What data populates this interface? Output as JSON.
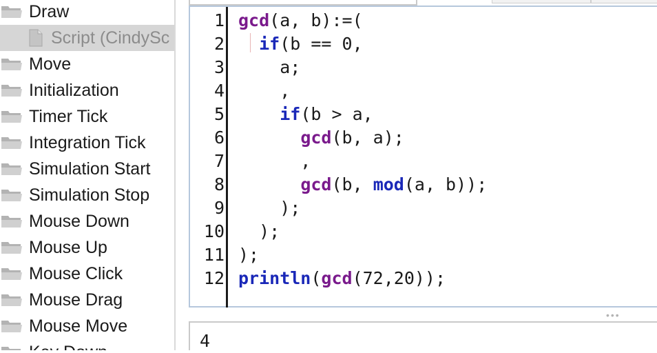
{
  "sidebar": {
    "items": [
      {
        "label": "Draw",
        "icon": "folder-icon"
      },
      {
        "label": "Script (CindySc",
        "icon": "document-icon",
        "selected": true
      },
      {
        "label": "Move",
        "icon": "folder-icon"
      },
      {
        "label": "Initialization",
        "icon": "folder-icon"
      },
      {
        "label": "Timer Tick",
        "icon": "folder-icon"
      },
      {
        "label": "Integration Tick",
        "icon": "folder-icon"
      },
      {
        "label": "Simulation Start",
        "icon": "folder-icon"
      },
      {
        "label": "Simulation Stop",
        "icon": "folder-icon"
      },
      {
        "label": "Mouse Down",
        "icon": "folder-icon"
      },
      {
        "label": "Mouse Up",
        "icon": "folder-icon"
      },
      {
        "label": "Mouse Click",
        "icon": "folder-icon"
      },
      {
        "label": "Mouse Drag",
        "icon": "folder-icon"
      },
      {
        "label": "Mouse Move",
        "icon": "folder-icon"
      },
      {
        "label": "Key Down",
        "icon": "folder-icon"
      }
    ]
  },
  "editor": {
    "line_numbers": [
      "1",
      "2",
      "3",
      "4",
      "5",
      "6",
      "7",
      "8",
      "9",
      "10",
      "11",
      "12"
    ],
    "lines": [
      [
        {
          "t": "gcd",
          "c": "fn"
        },
        {
          "t": "(a, b):=(",
          "c": ""
        }
      ],
      [
        {
          "t": "  ",
          "c": ""
        },
        {
          "t": "if",
          "c": "kw"
        },
        {
          "t": "(b == 0,",
          "c": ""
        }
      ],
      [
        {
          "t": "    a;",
          "c": ""
        }
      ],
      [
        {
          "t": "    ,",
          "c": ""
        }
      ],
      [
        {
          "t": "    ",
          "c": ""
        },
        {
          "t": "if",
          "c": "kw"
        },
        {
          "t": "(b > a,",
          "c": ""
        }
      ],
      [
        {
          "t": "      ",
          "c": ""
        },
        {
          "t": "gcd",
          "c": "fn"
        },
        {
          "t": "(b, a);",
          "c": ""
        }
      ],
      [
        {
          "t": "      ,",
          "c": ""
        }
      ],
      [
        {
          "t": "      ",
          "c": ""
        },
        {
          "t": "gcd",
          "c": "fn"
        },
        {
          "t": "(b, ",
          "c": ""
        },
        {
          "t": "mod",
          "c": "kw"
        },
        {
          "t": "(a, b));",
          "c": ""
        }
      ],
      [
        {
          "t": "    );",
          "c": ""
        }
      ],
      [
        {
          "t": "  );",
          "c": ""
        }
      ],
      [
        {
          "t": ");",
          "c": ""
        }
      ],
      [
        {
          "t": "println",
          "c": "kw"
        },
        {
          "t": "(",
          "c": ""
        },
        {
          "t": "gcd",
          "c": "fn"
        },
        {
          "t": "(72,20));",
          "c": ""
        }
      ]
    ]
  },
  "splitter": {
    "label": "•••"
  },
  "console": {
    "output": "4"
  },
  "colors": {
    "keyword": "#1a28b8",
    "function": "#7a1a8c",
    "editor_border": "#b5c7dc",
    "selected_bg": "#d6d6d6"
  }
}
